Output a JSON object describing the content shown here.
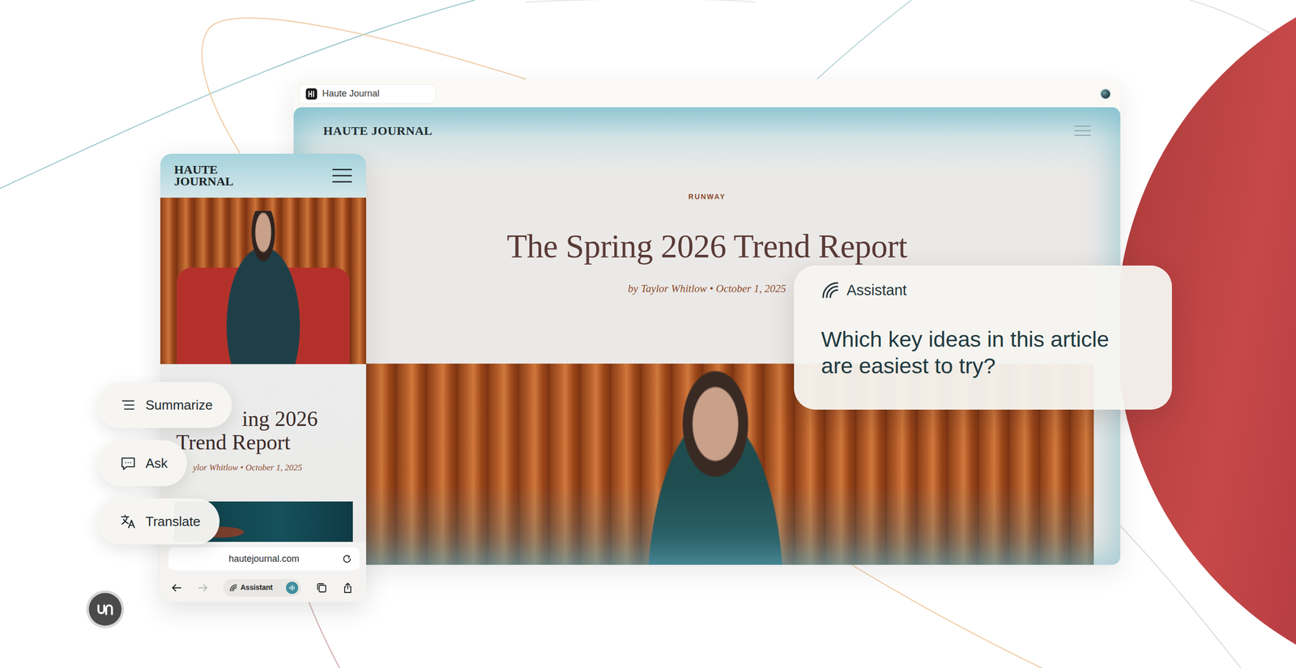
{
  "desktop": {
    "tab": {
      "label": "Haute Journal"
    },
    "site": {
      "logo": "HAUTE JOURNAL",
      "section": "RUNWAY",
      "title": "The Spring 2026 Trend Report",
      "byline": "by Taylor Whitlow • October 1, 2025"
    }
  },
  "assistant_card": {
    "label": "Assistant",
    "question": "Which key ideas in this article are easiest to try?"
  },
  "mobile": {
    "logo": "HAUTE JOURNAL",
    "title_lines": [
      "ing 2026",
      "Trend Report"
    ],
    "byline": "ylor Whitlow • October 1, 2025",
    "url": "hautejournal.com",
    "toolbar": {
      "back_disabled": false,
      "forward_disabled": true,
      "assistant": "Assistant"
    }
  },
  "actions": [
    {
      "label": "Summarize",
      "kind": "summarize"
    },
    {
      "label": "Ask",
      "kind": "ask"
    },
    {
      "label": "Translate",
      "kind": "translate"
    }
  ]
}
